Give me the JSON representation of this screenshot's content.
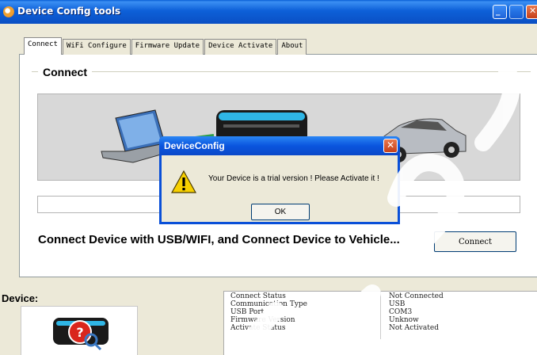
{
  "window": {
    "title": "Device Config tools"
  },
  "tabs": [
    {
      "label": "Connect",
      "active": true
    },
    {
      "label": "WiFi Configure",
      "active": false
    },
    {
      "label": "Firmware Update",
      "active": false
    },
    {
      "label": "Device Activate",
      "active": false
    },
    {
      "label": "About",
      "active": false
    }
  ],
  "connect": {
    "group_title": "Connect",
    "message": "Connect Device with USB/WIFI, and Connect Device to Vehicle...",
    "connect_button": "Connect"
  },
  "device": {
    "label": "Device:",
    "status": [
      {
        "key": "Connect Status",
        "value": "Not Connected"
      },
      {
        "key": "Communication Type",
        "value": "USB"
      },
      {
        "key": "USB Port",
        "value": "COM3"
      },
      {
        "key": "Firmware Version",
        "value": "Unknow"
      },
      {
        "key": "Activate Status",
        "value": "Not Activated"
      }
    ]
  },
  "dialog": {
    "title": "DeviceConfig",
    "message": "Your Device is a trial version ! Please Activate it !",
    "ok_label": "OK"
  },
  "icons": {
    "app": "app-icon",
    "warning": "warning-icon",
    "laptop": "laptop-icon",
    "device": "obd-device-icon",
    "car": "car-icon",
    "device_unknown": "device-unknown-icon"
  },
  "colors": {
    "titlebar": "#0a50d8",
    "face": "#ece9d8",
    "close_button": "#c5401a"
  }
}
